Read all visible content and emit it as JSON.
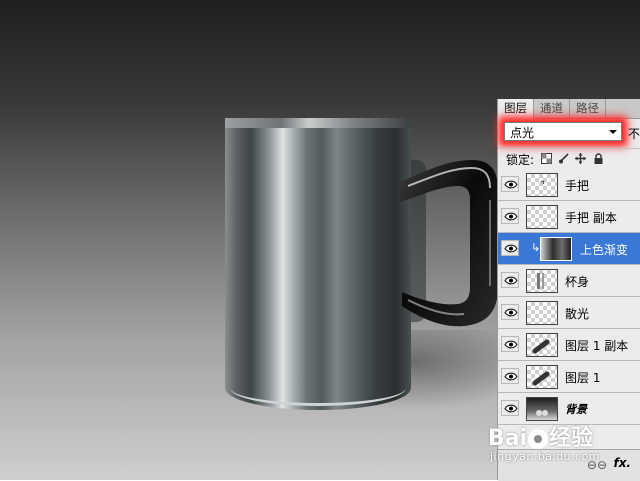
{
  "panel": {
    "tabs": [
      {
        "label": "图层",
        "active": true
      },
      {
        "label": "通道",
        "active": false
      },
      {
        "label": "路径",
        "active": false
      }
    ],
    "blend_mode": "点光",
    "opacity_label": "不",
    "lock_label": "锁定:",
    "layers": [
      {
        "name": "手把",
        "thumb": "transparent",
        "selected": false
      },
      {
        "name": "手把 副本",
        "thumb": "transparent",
        "selected": false
      },
      {
        "name": "上色渐变",
        "thumb": "gradient",
        "selected": true
      },
      {
        "name": "杯身",
        "thumb": "transparent-bars",
        "selected": false
      },
      {
        "name": "散光",
        "thumb": "transparent",
        "selected": false
      },
      {
        "name": "图层 1 副本",
        "thumb": "transparent-stroke",
        "selected": false
      },
      {
        "name": "图层 1",
        "thumb": "transparent-stroke",
        "selected": false
      },
      {
        "name": "背景",
        "thumb": "background",
        "selected": false
      }
    ],
    "fx_label": "fx."
  },
  "watermark": {
    "logo_prefix": "Bai",
    "logo_suffix": "经验",
    "url": "jingyan.baidu.com"
  },
  "colors": {
    "highlight_glow": "#ff2a2a",
    "selected_layer": "#3a78d8"
  }
}
